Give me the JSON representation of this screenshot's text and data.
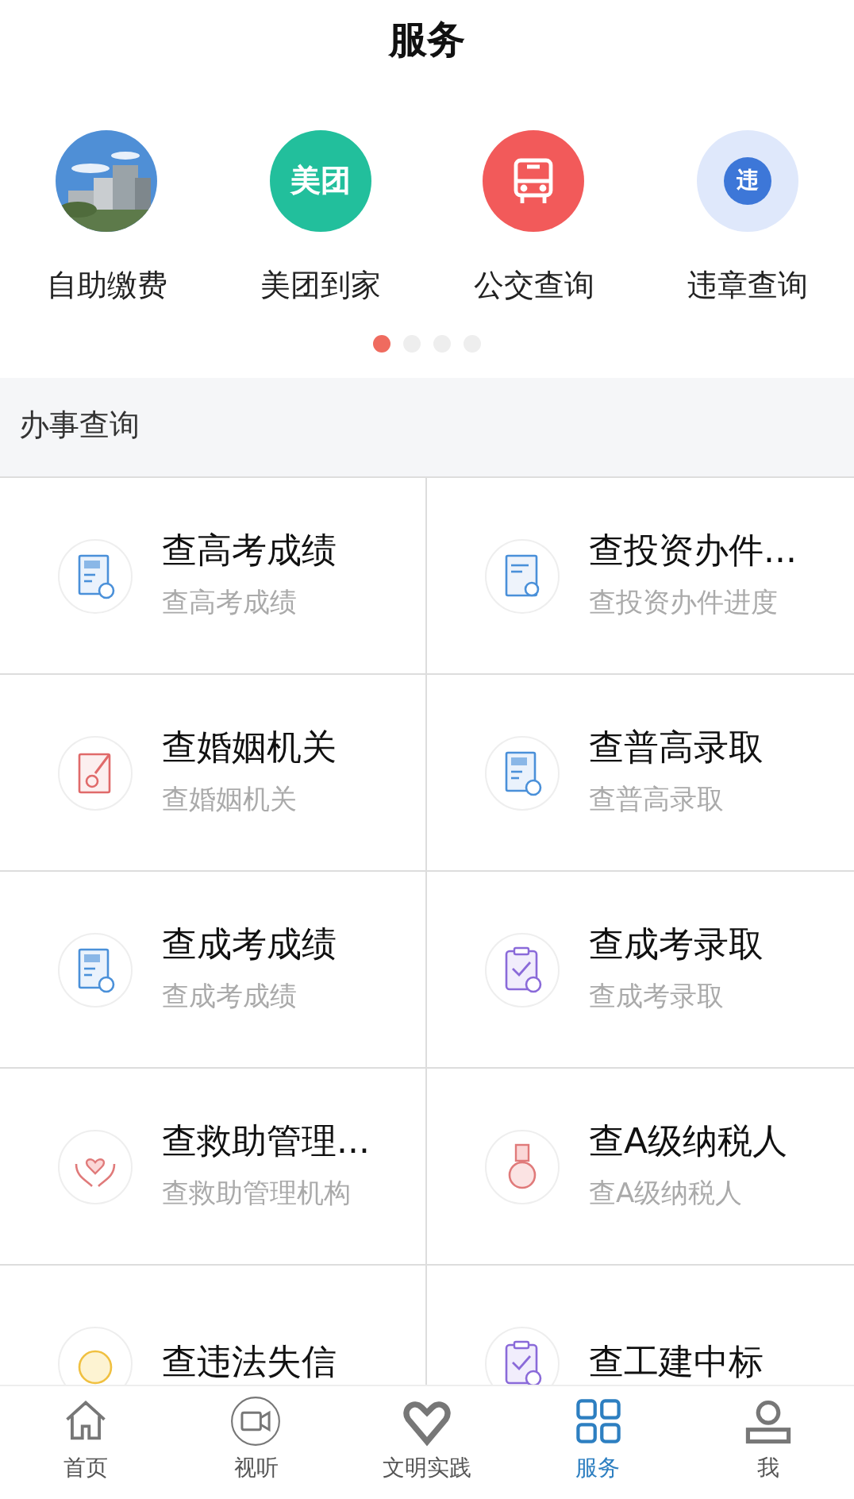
{
  "header": {
    "title": "服务"
  },
  "quick_links": [
    {
      "label": "自助缴费",
      "kind": "picture"
    },
    {
      "label": "美团到家",
      "kind": "badge",
      "icon_text": "美团"
    },
    {
      "label": "公交查询",
      "kind": "bus"
    },
    {
      "label": "违章查询",
      "kind": "badge-search",
      "icon_text": "违"
    }
  ],
  "pager": [
    {
      "selected": true
    },
    {
      "selected": false
    },
    {
      "selected": false
    },
    {
      "selected": false
    }
  ],
  "section": {
    "title": "办事查询"
  },
  "services": [
    {
      "title": "查高考成绩",
      "subtitle": "查高考成绩",
      "kind": "score-sheet"
    },
    {
      "title": "查投资办件...",
      "subtitle": "查投资办件进度",
      "kind": "doc-search"
    },
    {
      "title": "查婚姻机关",
      "subtitle": "查婚姻机关",
      "kind": "pen-doc"
    },
    {
      "title": "查普高录取",
      "subtitle": "查普高录取",
      "kind": "score-sheet"
    },
    {
      "title": "查成考成绩",
      "subtitle": "查成考成绩",
      "kind": "score-sheet"
    },
    {
      "title": "查成考录取",
      "subtitle": "查成考录取",
      "kind": "clipboard"
    },
    {
      "title": "查救助管理...",
      "subtitle": "查救助管理机构",
      "kind": "hands"
    },
    {
      "title": "查A级纳税人",
      "subtitle": "查A级纳税人",
      "kind": "medal"
    },
    {
      "title": "查违法失信",
      "kind": "coin"
    },
    {
      "title": "查工建中标",
      "kind": "clipboard"
    }
  ],
  "tab_bar": [
    {
      "label": "首页",
      "kind": "home",
      "selected": false
    },
    {
      "label": "视听",
      "kind": "video",
      "selected": false
    },
    {
      "label": "文明实践",
      "kind": "heart",
      "selected": false
    },
    {
      "label": "服务",
      "kind": "grid",
      "selected": true
    },
    {
      "label": "我",
      "kind": "user",
      "selected": false
    }
  ]
}
